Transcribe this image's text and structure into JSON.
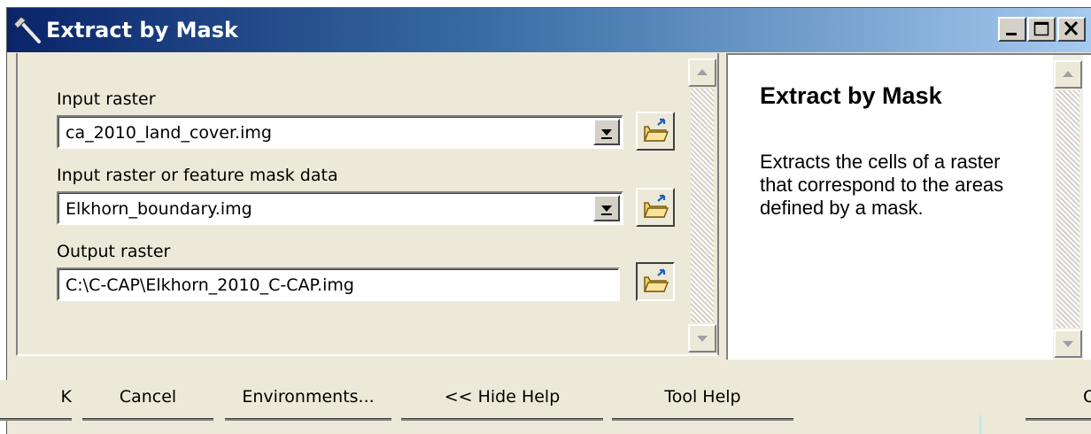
{
  "window": {
    "title": "Extract by Mask",
    "accent": "#0a246a"
  },
  "title_buttons": {
    "minimize_icon": "minimize-icon",
    "maximize_icon": "maximize-icon",
    "close_icon": "close-icon"
  },
  "form": {
    "fields": [
      {
        "label": "Input raster",
        "value": "ca_2010_land_cover.img",
        "type": "dropdown"
      },
      {
        "label": "Input raster or feature mask data",
        "value": "Elkhorn_boundary.img",
        "type": "dropdown"
      },
      {
        "label": "Output raster",
        "value": "C:\\C-CAP\\Elkhorn_2010_C-CAP.img",
        "type": "text"
      }
    ],
    "browse_icon": "open-folder-icon"
  },
  "help": {
    "title": "Extract by Mask",
    "body": "Extracts the cells of a raster that correspond to the areas defined by a mask."
  },
  "buttons": {
    "ok": "K",
    "cancel": "Cancel",
    "environments": "Environments...",
    "hide_help": "<< Hide Help",
    "tool_help": "Tool Help",
    "partial": "O"
  }
}
